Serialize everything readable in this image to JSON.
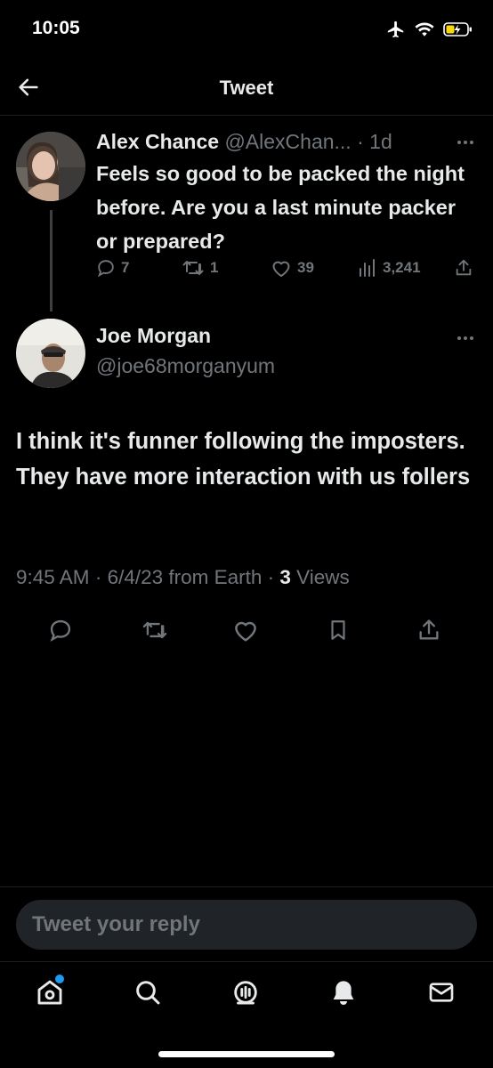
{
  "status_bar": {
    "time": "10:05"
  },
  "header": {
    "title": "Tweet"
  },
  "parent_tweet": {
    "author_name": "Alex Chance",
    "author_handle": "@AlexChan...",
    "separator": " · ",
    "age": "1d",
    "text": "Feels so good to be packed the night before. Are you a last minute packer or prepared?",
    "replies": "7",
    "retweets": "1",
    "likes": "39",
    "views": "3,241"
  },
  "main_tweet": {
    "author_name": "Joe Morgan",
    "author_handle": "@joe68morganyum",
    "text": "I think it's funner following the imposters. They have more interaction with us follers",
    "time": "9:45 AM",
    "sep1": " · ",
    "date": "6/4/23 from Earth",
    "sep2": " · ",
    "views_count": "3",
    "views_label": " Views"
  },
  "reply_bar": {
    "placeholder": "Tweet your reply"
  },
  "colors": {
    "background": "#000000",
    "text_primary": "#e7e9ea",
    "text_secondary": "#71767b",
    "accent": "#1d9bf0"
  },
  "icons": {
    "back": "arrow-left-icon",
    "reply": "speech-bubble-icon",
    "retweet": "retweet-icon",
    "like": "heart-icon",
    "views": "bar-chart-icon",
    "bookmark": "bookmark-icon",
    "share": "share-icon",
    "home": "home-icon",
    "search": "search-icon",
    "spaces": "spaces-icon",
    "notifications": "bell-icon",
    "messages": "envelope-icon"
  }
}
